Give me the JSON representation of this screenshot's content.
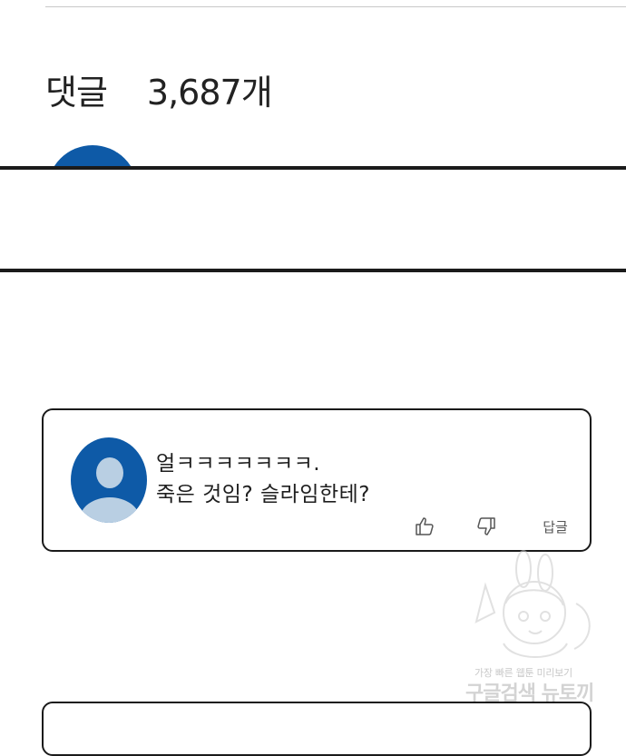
{
  "comments_section": {
    "title": "댓글",
    "count": "3,687개"
  },
  "comment": {
    "line1": "얼ㅋㅋㅋㅋㅋㅋㅋ.",
    "line2": "죽은 것임? 슬라임한테?",
    "like_icon": "thumbs-up-icon",
    "dislike_icon": "thumbs-down-icon",
    "reply_label": "답글"
  },
  "watermark": {
    "line1": "가장 빠른 웹툰 미리보기",
    "line2": "구글검색 뉴토끼"
  },
  "colors": {
    "avatar": "#0e5aa7",
    "avatar_silhouette": "#b9cfe3",
    "panel_border": "#1a1a1a"
  }
}
